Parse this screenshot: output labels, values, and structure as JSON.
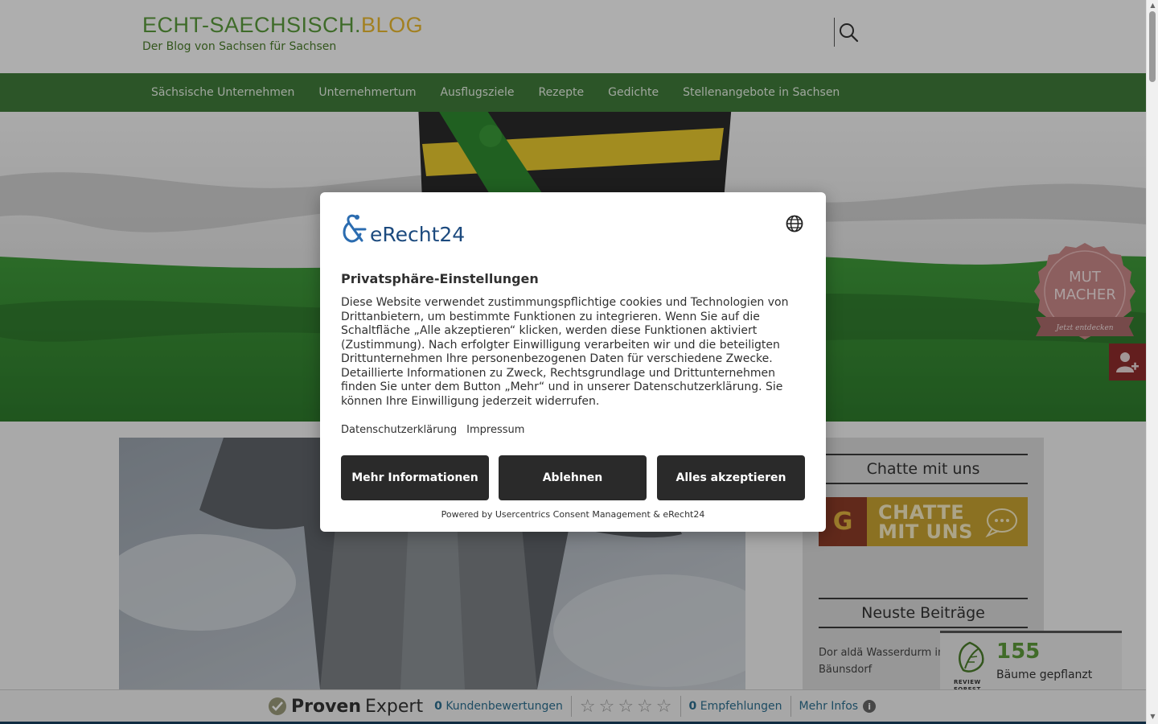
{
  "header": {
    "logo_main": "ECHT-SAECHSISCH.",
    "logo_suffix": "BLOG",
    "tagline": "Der Blog von Sachsen für Sachsen"
  },
  "nav": {
    "items": [
      {
        "label": "Sächsische Unternehmen"
      },
      {
        "label": "Unternehmertum"
      },
      {
        "label": "Ausflugsziele"
      },
      {
        "label": "Rezepte"
      },
      {
        "label": "Gedichte"
      },
      {
        "label": "Stellenangebote in Sachsen"
      }
    ]
  },
  "badge": {
    "line1": "MUT",
    "line2": "MACHER",
    "ribbon": "Jetzt entdecken"
  },
  "sidebar": {
    "chat_title": "Chatte mit uns",
    "chat_banner_line1": "CHATTE",
    "chat_banner_line2": "MIT UNS",
    "chat_logo_letter": "G",
    "latest_title": "Neuste Beiträge",
    "latest_posts": [
      {
        "title": "Dor aldä Wasserdurm in Bäunsdorf"
      }
    ]
  },
  "review_forest": {
    "count": "155",
    "label": "Bäume gepflanzt",
    "logo_line1": "REVIEW",
    "logo_line2": "FOREST"
  },
  "proven_expert": {
    "brand1": "Proven",
    "brand2": "Expert",
    "reviews_count": "0",
    "reviews_label": "Kundenbewertungen",
    "recommend_count": "0",
    "recommend_label": "Empfehlungen",
    "more_info": "Mehr Infos",
    "stars": 0
  },
  "consent": {
    "logo_text": "eRecht24",
    "title": "Privatsphäre-Einstellungen",
    "body": "Diese Website verwendet zustimmungspflichtige cookies und Technologien von Drittanbietern, um bestimmte Funktionen zu integrieren. Wenn Sie auf die Schaltfläche „Alle akzeptieren“ klicken, werden diese Funktionen aktiviert (Zustimmung). Nach erfolgter Einwilligung verarbeiten wir und die beteiligten Drittunternehmen Ihre personenbezogenen Daten für verschiedene Zwecke. Detaillierte Informationen zu Zweck, Rechtsgrundlage und Drittunternehmen finden Sie unter dem Button „Mehr“ und in unserer Datenschutzerklärung. Sie können Ihre Einwilligung jederzeit widerrufen.",
    "link_privacy": "Datenschutzerklärung",
    "link_imprint": "Impressum",
    "btn_more": "Mehr Informationen",
    "btn_decline": "Ablehnen",
    "btn_accept": "Alles akzeptieren",
    "powered_by": "Powered by Usercentrics Consent Management & eRecht24"
  },
  "colors": {
    "nav_green": "#3f7a3a",
    "brand_green": "#5a9a3c",
    "brand_yellow": "#e8b830",
    "button_dark": "#2a2a2a",
    "erecht_blue": "#1c4a7e"
  }
}
